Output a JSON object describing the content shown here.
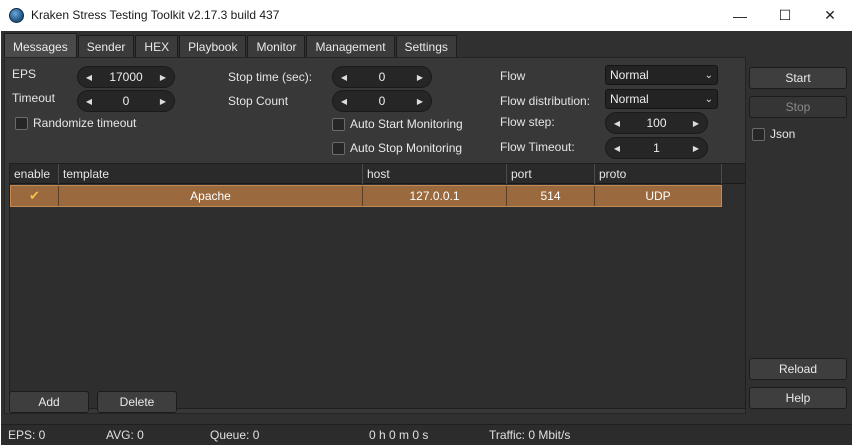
{
  "window": {
    "title": "Kraken Stress Testing Toolkit v2.17.3 build 437",
    "minimize_glyph": "—",
    "maximize_glyph": "☐",
    "close_glyph": "✕"
  },
  "tabs": [
    {
      "label": "Messages",
      "active": true
    },
    {
      "label": "Sender"
    },
    {
      "label": "HEX"
    },
    {
      "label": "Playbook"
    },
    {
      "label": "Monitor"
    },
    {
      "label": "Management"
    },
    {
      "label": "Settings"
    }
  ],
  "settings": {
    "eps_label": "EPS",
    "eps_value": "17000",
    "timeout_label": "Timeout",
    "timeout_value": "0",
    "randomize_timeout_label": "Randomize timeout",
    "stop_time_label": "Stop time (sec):",
    "stop_time_value": "0",
    "stop_count_label": "Stop Count",
    "stop_count_value": "0",
    "auto_start_label": "Auto Start Monitoring",
    "auto_stop_label": "Auto Stop Monitoring",
    "flow_label": "Flow",
    "flow_value": "Normal",
    "flow_distribution_label": "Flow distribution:",
    "flow_distribution_value": "Normal",
    "flow_step_label": "Flow step:",
    "flow_step_value": "100",
    "flow_timeout_label": "Flow Timeout:",
    "flow_timeout_value": "1",
    "arrow_left": "◀",
    "arrow_right": "▶",
    "chevron": "⌄"
  },
  "table": {
    "columns": [
      "enable",
      "template",
      "host",
      "port",
      "proto"
    ],
    "rows": [
      {
        "enable": "✔",
        "template": "Apache",
        "host": "127.0.0.1",
        "port": "514",
        "proto": "UDP"
      }
    ]
  },
  "buttons": {
    "add": "Add",
    "delete": "Delete",
    "start": "Start",
    "stop": "Stop",
    "json": "Json",
    "reload": "Reload",
    "help": "Help"
  },
  "status": {
    "eps": "EPS: 0",
    "avg": "AVG: 0",
    "queue": "Queue: 0",
    "time": "0 h 0 m 0 s",
    "traffic": "Traffic: 0 Mbit/s"
  },
  "colors": {
    "selected_row": "#9a6a3e",
    "background": "#303030",
    "check": "#f3c14a"
  }
}
